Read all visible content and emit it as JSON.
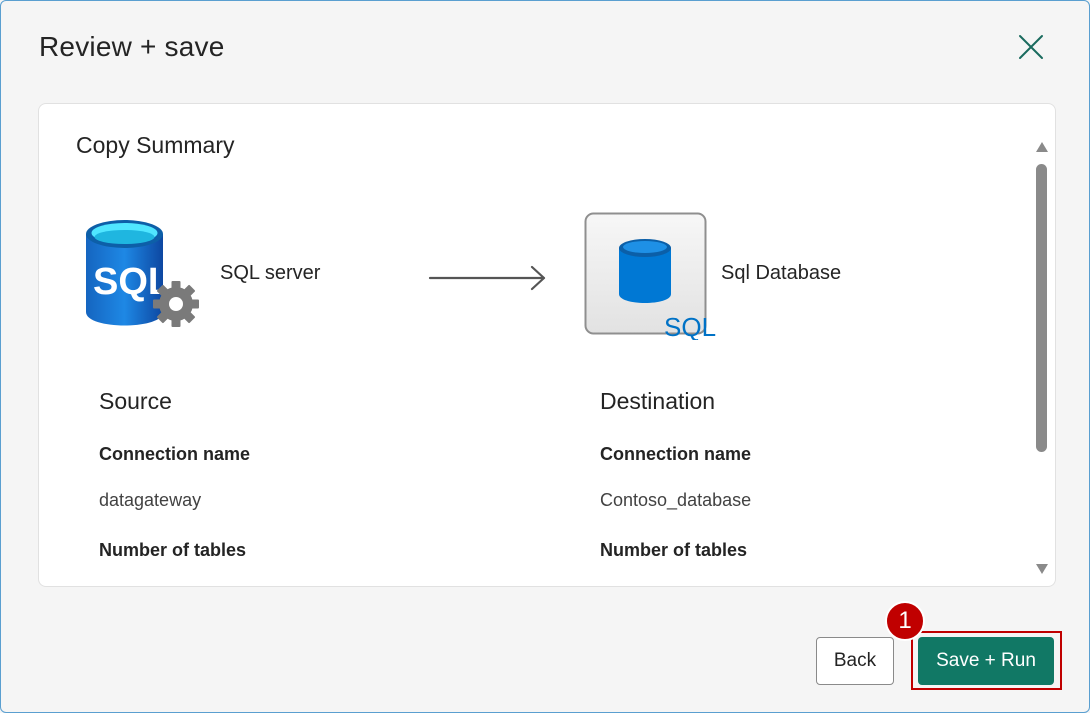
{
  "dialog": {
    "title": "Review + save",
    "close_icon": "close-icon"
  },
  "summary": {
    "title": "Copy Summary",
    "source": {
      "name": "SQL server",
      "icon": "sql-server-icon",
      "icon_text": "SQL",
      "heading": "Source",
      "connection_label": "Connection name",
      "connection_value": "datagateway",
      "tables_label": "Number of tables"
    },
    "destination": {
      "name": "Sql Database",
      "icon": "sql-database-icon",
      "icon_text": "SQL",
      "heading": "Destination",
      "connection_label": "Connection name",
      "connection_value": "Contoso_database",
      "tables_label": "Number of tables"
    }
  },
  "footer": {
    "back_label": "Back",
    "save_run_label": "Save + Run",
    "step_number": "1"
  },
  "colors": {
    "primary": "#117865",
    "highlight": "#c00000",
    "sql_blue": "#0072c6"
  }
}
